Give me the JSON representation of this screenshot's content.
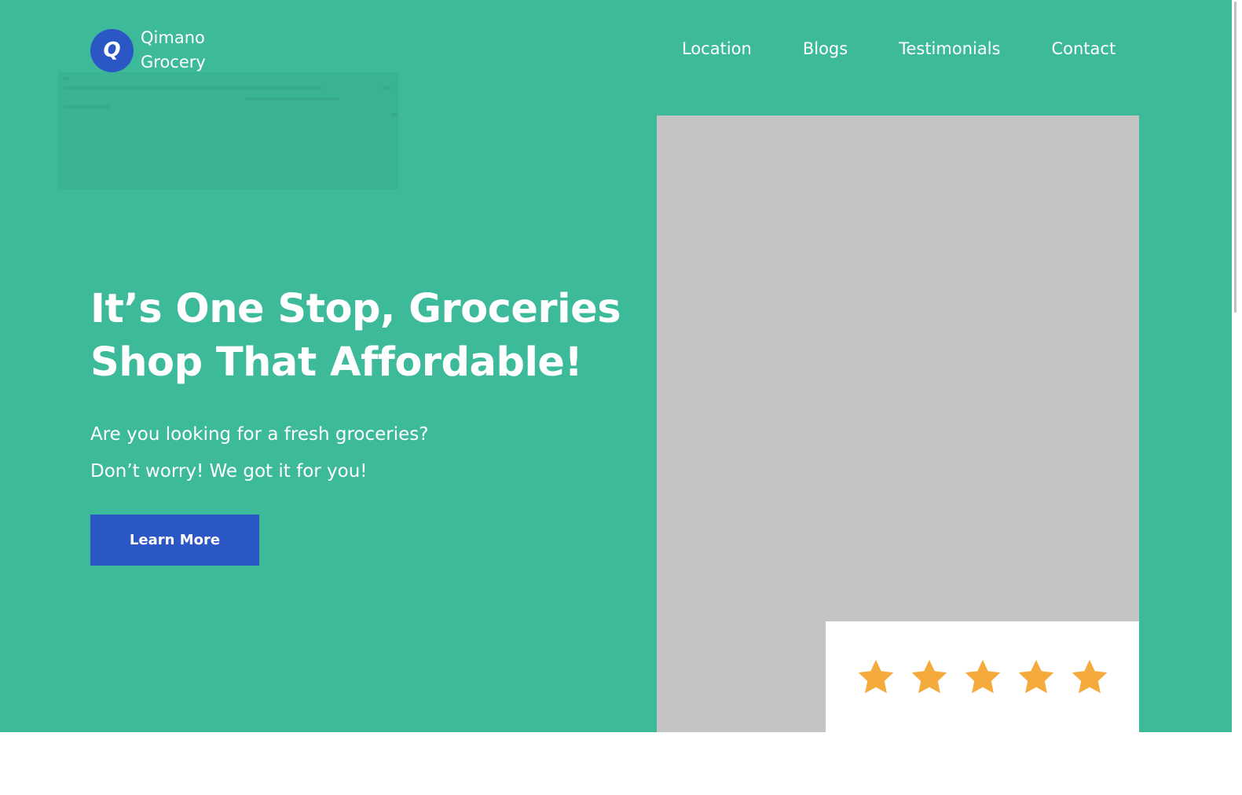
{
  "brand": {
    "mark": "Q",
    "name_line1": "Qimano",
    "name_line2": "Grocery",
    "primary_color": "#2a57c4",
    "hero_color": "#3dba9a"
  },
  "nav": {
    "items": [
      {
        "label": "Location"
      },
      {
        "label": "Blogs"
      },
      {
        "label": "Testimonials"
      },
      {
        "label": "Contact"
      }
    ]
  },
  "hero": {
    "headline_line1": "It’s One Stop, Groceries",
    "headline_line2": "Shop That Affordable!",
    "sub_line1": "Are you looking for a fresh groceries?",
    "sub_line2": "Don’t worry! We got it for you!",
    "cta_label": "Learn More",
    "image_color": "#c4c4c4"
  },
  "rating": {
    "stars": 5,
    "max": 5,
    "star_color": "#f5aa3c",
    "icon": "star-icon"
  }
}
